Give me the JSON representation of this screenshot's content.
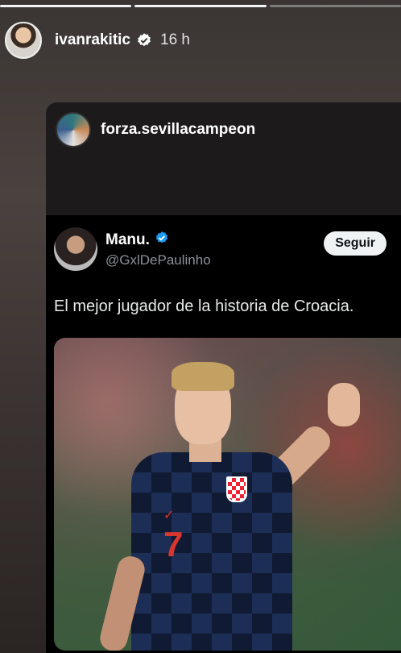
{
  "story": {
    "progress_segments": 3,
    "username": "ivanrakitic",
    "time": "16 h"
  },
  "shared_post": {
    "username": "forza.sevillacampeon"
  },
  "tweet": {
    "name": "Manu.",
    "handle": "@GxlDePaulinho",
    "follow_label": "Seguir",
    "text": "El mejor jugador de la historia de Croacia."
  }
}
